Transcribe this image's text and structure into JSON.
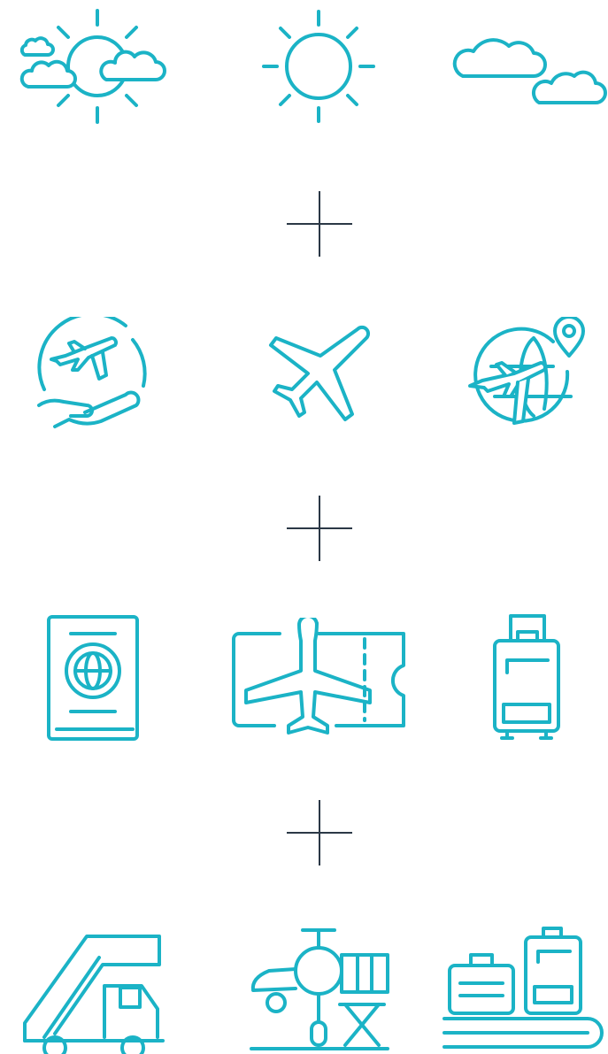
{
  "colors": {
    "accent": "#1bb3c6",
    "plus": "#2b3846",
    "background": "#ffffff"
  },
  "rows": [
    {
      "name": "weather",
      "icons": [
        "sun-behind-clouds-icon",
        "sun-icon",
        "clouds-icon"
      ]
    },
    {
      "name": "flight",
      "icons": [
        "plane-over-hand-icon",
        "airplane-icon",
        "globe-plane-pin-icon"
      ]
    },
    {
      "name": "travel-documents",
      "icons": [
        "passport-icon",
        "plane-ticket-icon",
        "suitcase-icon"
      ]
    },
    {
      "name": "airport",
      "icons": [
        "boarding-stairs-truck-icon",
        "plane-jet-bridge-icon",
        "baggage-carousel-icon"
      ]
    }
  ],
  "separators": [
    "plus-icon",
    "plus-icon",
    "plus-icon"
  ]
}
